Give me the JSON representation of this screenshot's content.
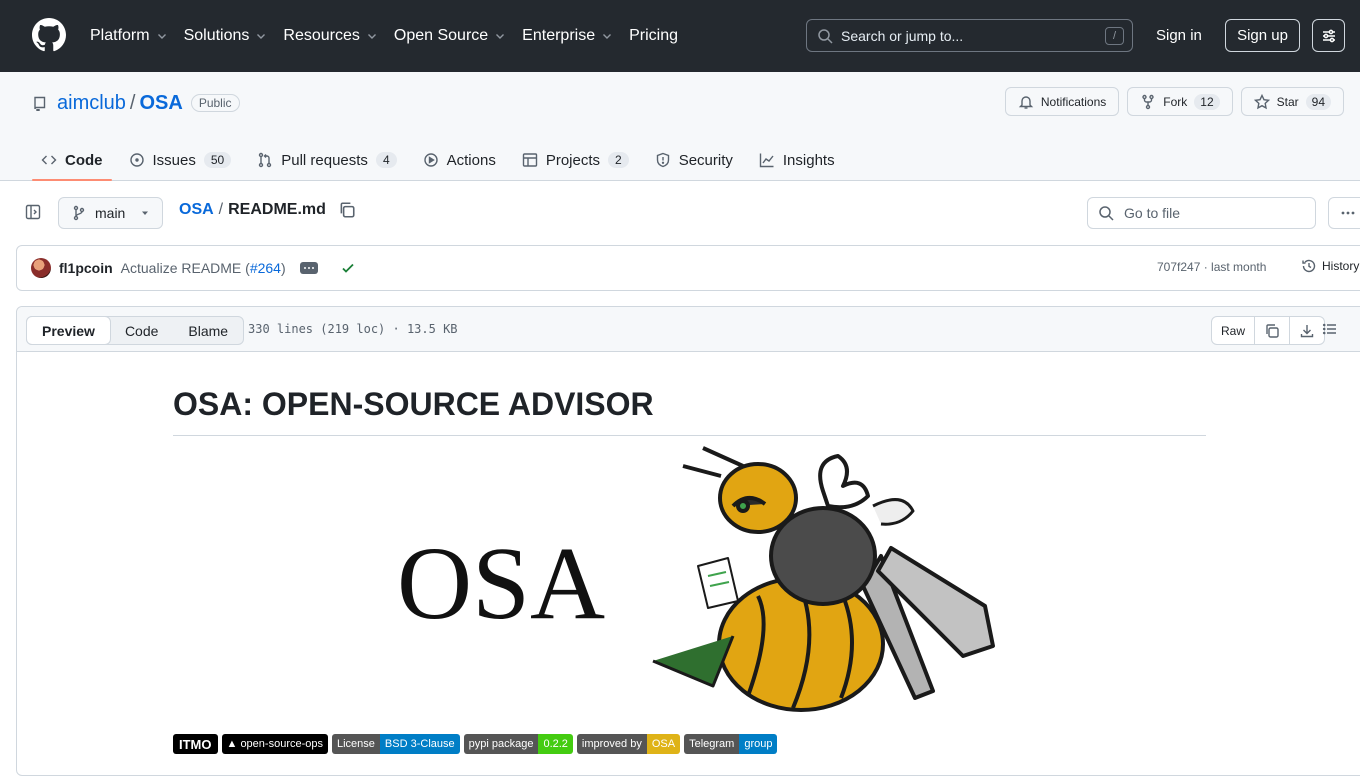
{
  "header": {
    "nav": [
      {
        "label": "Platform",
        "dropdown": true
      },
      {
        "label": "Solutions",
        "dropdown": true
      },
      {
        "label": "Resources",
        "dropdown": true
      },
      {
        "label": "Open Source",
        "dropdown": true
      },
      {
        "label": "Enterprise",
        "dropdown": true
      },
      {
        "label": "Pricing",
        "dropdown": false
      }
    ],
    "search_placeholder": "Search or jump to...",
    "search_shortcut": "/",
    "sign_in": "Sign in",
    "sign_up": "Sign up"
  },
  "repo": {
    "owner": "aimclub",
    "separator": "/",
    "name": "OSA",
    "visibility": "Public",
    "notifications_label": "Notifications",
    "fork_label": "Fork",
    "fork_count": "12",
    "star_label": "Star",
    "star_count": "94",
    "tabs": [
      {
        "label": "Code",
        "count": "",
        "icon": "code-icon",
        "active": true
      },
      {
        "label": "Issues",
        "count": "50",
        "icon": "issue-icon",
        "active": false
      },
      {
        "label": "Pull requests",
        "count": "4",
        "icon": "pull-request-icon",
        "active": false
      },
      {
        "label": "Actions",
        "count": "",
        "icon": "play-icon",
        "active": false
      },
      {
        "label": "Projects",
        "count": "2",
        "icon": "table-icon",
        "active": false
      },
      {
        "label": "Security",
        "count": "",
        "icon": "shield-icon",
        "active": false
      },
      {
        "label": "Insights",
        "count": "",
        "icon": "graph-icon",
        "active": false
      }
    ]
  },
  "file_bar": {
    "branch": "main",
    "path_repo": "OSA",
    "path_sep": "/",
    "path_file": "README.md",
    "goto_placeholder": "Go to file"
  },
  "commit": {
    "author": "fl1pcoin",
    "message": "Actualize README (",
    "pr_link": "#264",
    "message_end": ")",
    "sha_time": "707f247 · last month",
    "history": "History"
  },
  "viewer": {
    "modes": [
      "Preview",
      "Code",
      "Blame"
    ],
    "active_mode": "Preview",
    "file_info": "330 lines (219 loc) · 13.5 KB",
    "raw": "Raw"
  },
  "readme": {
    "title": "OSA: OPEN-SOURCE ADVISOR",
    "logo_text": "OSA",
    "badges": [
      {
        "left": "ITMO",
        "right": "",
        "left_color": "#000000",
        "right_color": ""
      },
      {
        "left": "▲ open-source-ops",
        "right": "",
        "left_color": "#000000",
        "right_color": ""
      },
      {
        "left": "License",
        "right": "BSD 3-Clause",
        "left_color": "#555555",
        "right_color": "#007ec6"
      },
      {
        "left": "pypi package",
        "right": "0.2.2",
        "left_color": "#555555",
        "right_color": "#4c1"
      },
      {
        "left": "improved by",
        "right": "OSA",
        "left_color": "#555555",
        "right_color": "#dfb317"
      },
      {
        "left": "Telegram",
        "right": "group",
        "left_color": "#555555",
        "right_color": "#007ec6"
      }
    ]
  },
  "colors": {
    "header_bg": "#24292f",
    "link": "#0969da",
    "tab_underline": "#fd8c73",
    "success": "#1a7f37"
  }
}
